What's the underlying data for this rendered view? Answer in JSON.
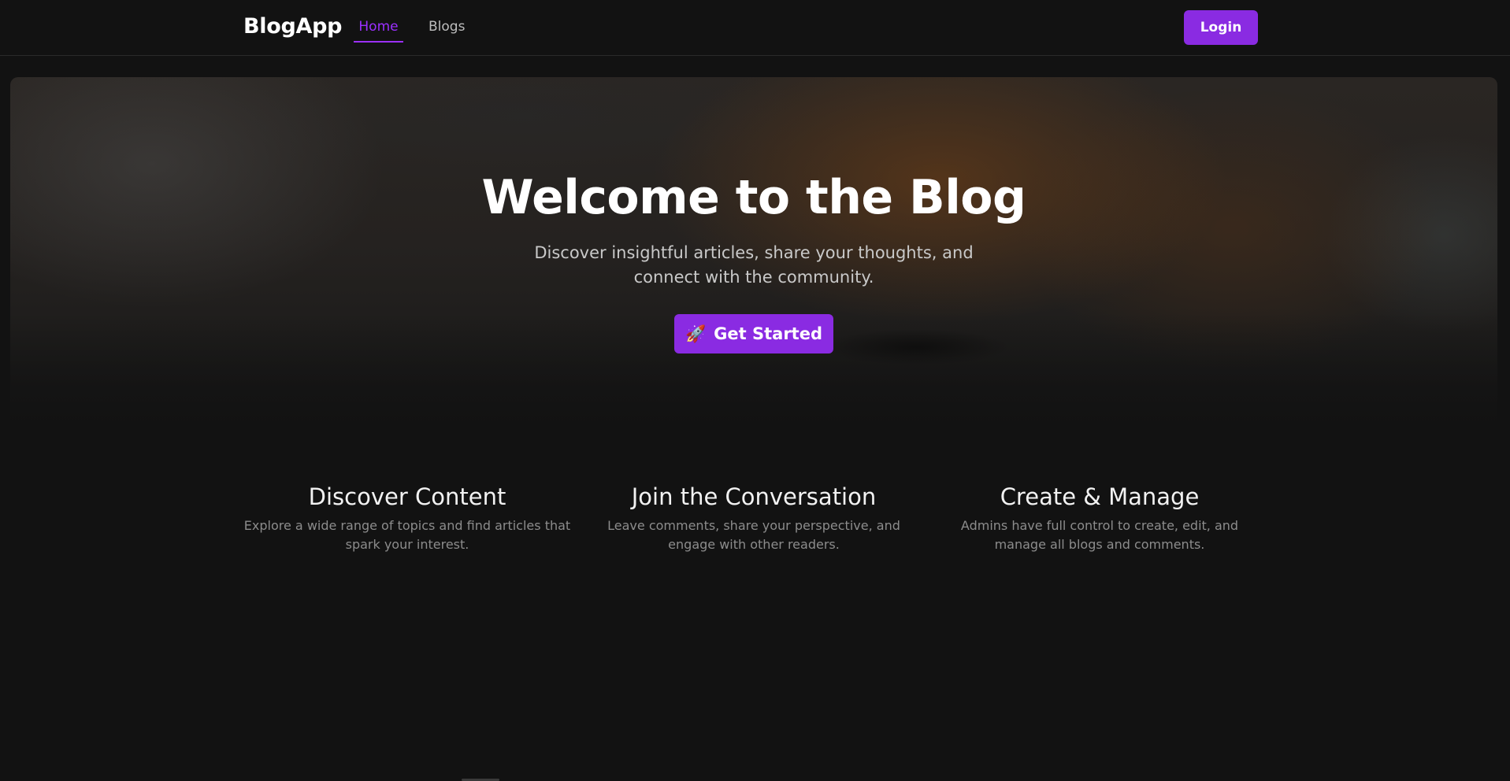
{
  "navbar": {
    "brand": "BlogApp",
    "links": [
      {
        "label": "Home",
        "active": true
      },
      {
        "label": "Blogs",
        "active": false
      }
    ],
    "login_label": "Login"
  },
  "hero": {
    "title": "Welcome to the Blog",
    "subtitle": "Discover insightful articles, share your thoughts, and connect with the community.",
    "cta": {
      "icon": "🚀",
      "icon_name": "rocket-icon",
      "label": "Get Started"
    }
  },
  "features": [
    {
      "title": "Discover Content",
      "description": "Explore a wide range of topics and find articles that spark your interest."
    },
    {
      "title": "Join the Conversation",
      "description": "Leave comments, share your perspective, and engage with other readers."
    },
    {
      "title": "Create & Manage",
      "description": "Admins have full control to create, edit, and manage all blogs and comments."
    }
  ],
  "colors": {
    "background": "#121212",
    "accent": "#8a2be2",
    "active_link": "#9b30ff",
    "text_muted": "#8c8c8c"
  }
}
